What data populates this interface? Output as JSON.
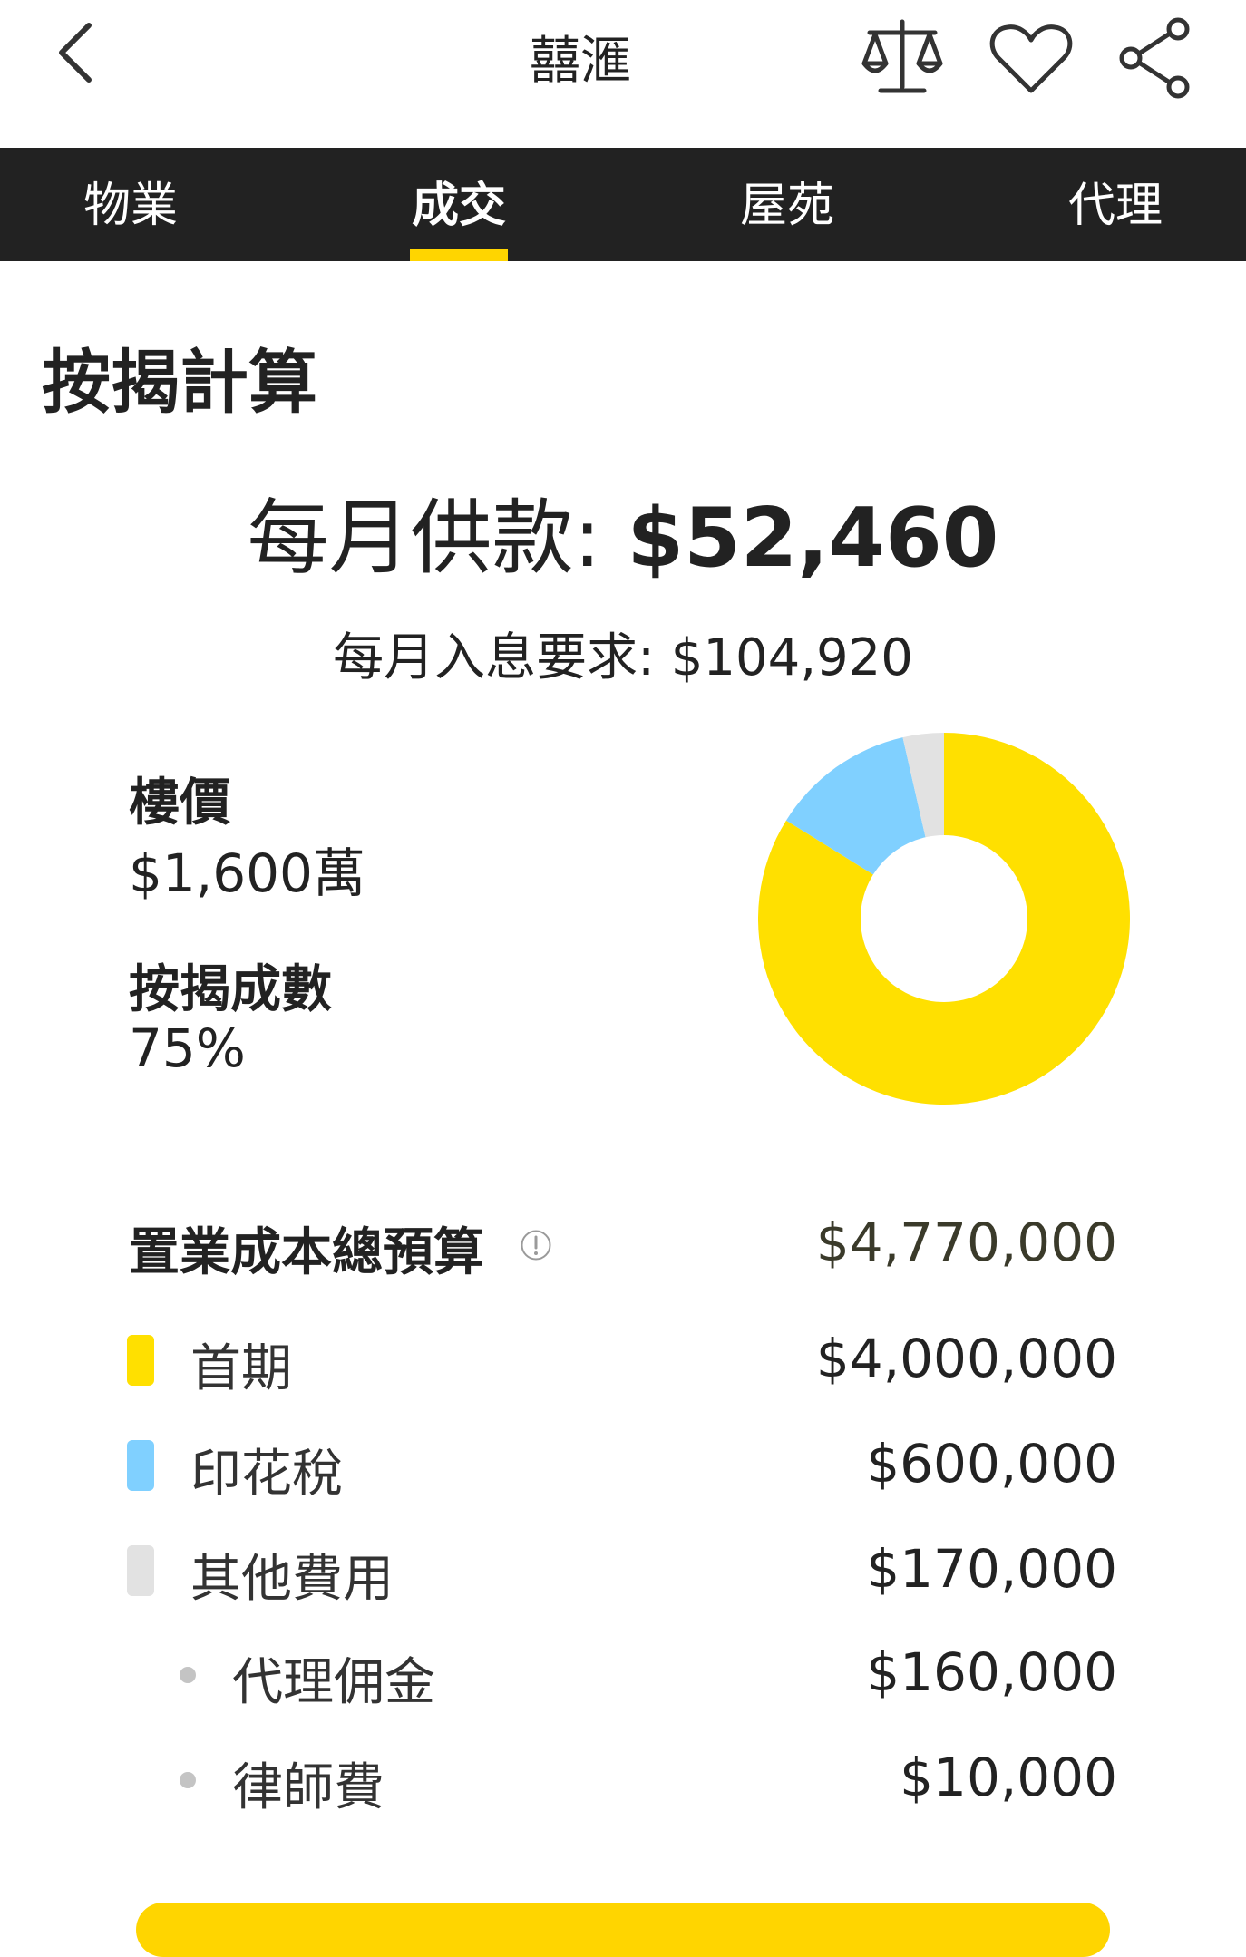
{
  "header": {
    "title": "囍滙",
    "back_icon": "chevron-left-icon",
    "compare_icon": "scale-icon",
    "favorite_icon": "heart-icon",
    "share_icon": "share-icon"
  },
  "tabs": [
    {
      "label": "物業",
      "active": false
    },
    {
      "label": "成交",
      "active": true
    },
    {
      "label": "屋苑",
      "active": false
    },
    {
      "label": "代理",
      "active": false
    }
  ],
  "mortgage": {
    "section_title": "按揭計算",
    "monthly_label": "每月供款: ",
    "monthly_value": "$52,460",
    "interest_label": "每月入息要求: $104,920",
    "price_label": "樓價",
    "price_value": "$1,600萬",
    "ratio_label": "按揭成數",
    "ratio_value": "75%"
  },
  "budget": {
    "title": "置業成本總預算",
    "total": "$4,770,000",
    "items": [
      {
        "label": "首期",
        "value": "$4,000,000",
        "color": "#FFE000"
      },
      {
        "label": "印花稅",
        "value": "$600,000",
        "color": "#80D0FF"
      },
      {
        "label": "其他費用",
        "value": "$170,000",
        "color": "#E2E2E2"
      }
    ],
    "sub_items": [
      {
        "label": "代理佣金",
        "value": "$160,000"
      },
      {
        "label": "律師費",
        "value": "$10,000"
      }
    ]
  },
  "chart_data": {
    "type": "pie",
    "categories": [
      "首期",
      "印花稅",
      "其他費用"
    ],
    "values": [
      4000000,
      600000,
      170000
    ],
    "colors": [
      "#FFE000",
      "#80D0FF",
      "#E2E2E2"
    ]
  },
  "colors": {
    "accent": "#FFD500",
    "tabbar_bg": "#222222"
  }
}
